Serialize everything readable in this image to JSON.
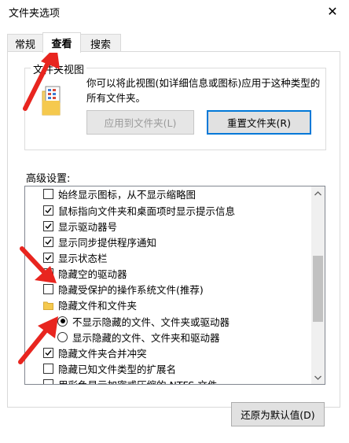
{
  "window": {
    "title": "文件夹选项",
    "close_label": "✕"
  },
  "tabs": [
    {
      "label": "常规"
    },
    {
      "label": "查看"
    },
    {
      "label": "搜索"
    }
  ],
  "folder_view": {
    "legend": "文件夹视图",
    "description": "你可以将此视图(如详细信息或图标)应用于这种类型的所有文件夹。",
    "apply_button": "应用到文件夹(L)",
    "reset_button": "重置文件夹(R)"
  },
  "advanced": {
    "label": "高级设置:",
    "items": [
      {
        "type": "checkbox",
        "checked": false,
        "label": "始终显示图标，从不显示缩略图"
      },
      {
        "type": "checkbox",
        "checked": true,
        "label": "鼠标指向文件夹和桌面项时显示提示信息"
      },
      {
        "type": "checkbox",
        "checked": true,
        "label": "显示驱动器号"
      },
      {
        "type": "checkbox",
        "checked": true,
        "label": "显示同步提供程序通知"
      },
      {
        "type": "checkbox",
        "checked": true,
        "label": "显示状态栏"
      },
      {
        "type": "checkbox",
        "checked": true,
        "label": "隐藏空的驱动器"
      },
      {
        "type": "checkbox",
        "checked": false,
        "label": "隐藏受保护的操作系统文件(推荐)"
      },
      {
        "type": "folder",
        "label": "隐藏文件和文件夹"
      },
      {
        "type": "radio",
        "checked": true,
        "label": "不显示隐藏的文件、文件夹或驱动器"
      },
      {
        "type": "radio",
        "checked": false,
        "label": "显示隐藏的文件、文件夹和驱动器"
      },
      {
        "type": "checkbox",
        "checked": true,
        "label": "隐藏文件夹合并冲突"
      },
      {
        "type": "checkbox",
        "checked": false,
        "label": "隐藏已知文件类型的扩展名"
      },
      {
        "type": "checkbox",
        "checked": false,
        "label": "用彩色显示加密或压缩的 NTFS 文件"
      }
    ]
  },
  "restore_button": "还原为默认值(D)",
  "colors": {
    "accent": "#0078d7",
    "annotation_arrow": "#e8251f"
  }
}
